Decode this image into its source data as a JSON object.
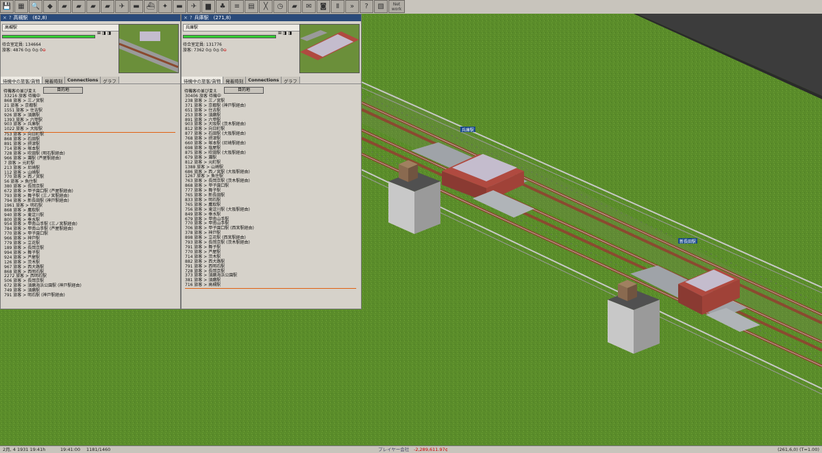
{
  "toolbar": {
    "buttons": [
      {
        "icon": "disk-icon",
        "glyph": "💾"
      },
      {
        "icon": "map-icon",
        "glyph": "▦"
      },
      {
        "icon": "magnifier-icon",
        "glyph": "🔍"
      },
      {
        "icon": "terrain-icon",
        "glyph": "◆"
      },
      {
        "icon": "road-icon",
        "glyph": "▰"
      },
      {
        "icon": "rail-icon",
        "glyph": "▰"
      },
      {
        "icon": "tram-icon",
        "glyph": "▰"
      },
      {
        "icon": "monorail-icon",
        "glyph": "▰"
      },
      {
        "icon": "plane-icon",
        "glyph": "✈"
      },
      {
        "icon": "train-icon",
        "glyph": "▬"
      },
      {
        "icon": "ship-icon",
        "glyph": "⛴"
      },
      {
        "icon": "signal-icon",
        "glyph": "✦"
      },
      {
        "icon": "ferry-icon",
        "glyph": "▬"
      },
      {
        "icon": "plane2-icon",
        "glyph": "✈"
      },
      {
        "icon": "truck-icon",
        "glyph": "▆"
      },
      {
        "icon": "tree-icon",
        "glyph": "♣"
      },
      {
        "icon": "list-icon",
        "glyph": "≡"
      },
      {
        "icon": "document-icon",
        "glyph": "▤"
      },
      {
        "icon": "crossing-icon",
        "glyph": "╳"
      },
      {
        "icon": "schedule-icon",
        "glyph": "◷"
      },
      {
        "icon": "folder-icon",
        "glyph": "▰"
      },
      {
        "icon": "message-icon",
        "glyph": "✉"
      },
      {
        "icon": "camera-icon",
        "glyph": "◙"
      },
      {
        "icon": "pause-icon",
        "glyph": "Ⅱ"
      },
      {
        "icon": "fastforward-icon",
        "glyph": "»"
      },
      {
        "icon": "help-icon",
        "glyph": "?"
      },
      {
        "icon": "grid-icon",
        "glyph": "▧"
      }
    ],
    "network_label": "Net work"
  },
  "windows": [
    {
      "title": "高槻駅　(62,8)",
      "station_name": "高槻駅",
      "capacity": "待合室定員: 134664",
      "waiting": "旅客: 4876",
      "goods_a": "0",
      "goods_b": "0",
      "mail": "0",
      "tabs": [
        "待機中の旅客/貨物",
        "発着時刻",
        "Connections",
        "グラフ"
      ],
      "sort_label": "待機客の並び変え",
      "sort_button": "目的地",
      "rows": [
        "33216 旅客 待機中",
        "868 旅客 > 三ノ宮駅",
        "21 旅客 > 京都駅",
        "1551 旅客 > 住吉駅",
        "926 旅客 > 須磨駅",
        "1393 旅客 > 六甲駅",
        "903 旅客 > 兵庫駅",
        "1022 旅客 > 大阪駅",
        "753 旅客 > 向日町駅",
        "868 旅客 > 石田駅",
        "891 旅客 > 摂津駅",
        "714 旅客 > 塚本駅",
        "728 旅客 > 吹田駅 (明石駅経由)",
        "966 旅客 > 灘駅 (芦屋駅経由)",
        "7 旅客 > 元町駅",
        "213 旅客 > 尼崎駅",
        "112 旅客 > 山崎駅",
        "770 旅客 > 西ノ宮駅",
        "56 旅客 > 魚住駅",
        "380 旅客 > 長岡京駅",
        "672 旅客 > 甲子園口駅 (芦屋駅経由)",
        "793 旅客 > 舞子駅 (三ノ宮駅経由)",
        "794 旅客 > 新長田駅 (神戸駅経由)",
        "1961 旅客 > 明石駅",
        "868 旅客 > 鷹取駅",
        "940 旅客 > 東淀川駅",
        "800 旅客 > 垂水駅",
        "954 旅客 > 甲南山手駅 (三ノ宮駅経由)",
        "784 旅客 > 甲南山手駅 (芦屋駅経由)",
        "770 旅客 > 甲子園口駅",
        "966 旅客 > 神戸駅",
        "779 旅客 > 立花駅",
        "189 旅客 > 長岡京駅",
        "994 旅客 > 舞子駅",
        "924 旅客 > 芦屋駅",
        "126 旅客 > 茨木駅",
        "967 旅客 > 西大路駅",
        "868 旅客 > 西明石駅",
        "2272 旅客 > 西明石駅",
        "506 旅客 > 長岡京駅",
        "672 旅客 > 須磨海浜公園駅 (神戸駅経由)",
        "749 旅客 > 須磨駅",
        "791 旅客 > 明石駅 (神戸駅経由)"
      ],
      "highlight_index": 7
    },
    {
      "title": "兵庫駅　(271,8)",
      "station_name": "兵庫駅",
      "capacity": "待合室定員: 131776",
      "waiting": "旅客: 7362",
      "goods_a": "0",
      "goods_b": "0",
      "mail": "0",
      "tabs": [
        "待機中の旅客/貨物",
        "発着時刻",
        "Connections",
        "グラフ"
      ],
      "sort_label": "待機客の並び変え",
      "sort_button": "目的地",
      "rows": [
        "30406 旅客 待機中",
        "238 旅客 > 三ノ宮駅",
        "371 旅客 > 京都駅 (神戸駅経由)",
        "651 旅客 > 住吉駅",
        "253 旅客 > 須磨駅",
        "891 旅客 > 六甲駅",
        "903 旅客 > 大阪駅 (茨木駅経由)",
        "812 旅客 > 向日町駅",
        "877 旅客 > 石田駅 (大阪駅経由)",
        "768 旅客 > 摂津駅",
        "660 旅客 > 塚本駅 (尼崎駅経由)",
        "698 旅客 > 塩屋駅",
        "875 旅客 > 吹田駅 (大阪駅経由)",
        "679 旅客 > 灘駅",
        "812 旅客 > 元町駅",
        "1388 旅客 > 山崎駅",
        "686 旅客 > 西ノ宮駅 (大阪駅経由)",
        "1267 旅客 > 魚住駅",
        "763 旅客 > 長岡京駅 (茨木駅経由)",
        "868 旅客 > 甲子園口駅",
        "777 旅客 > 舞子駅",
        "765 旅客 > 新長田駅",
        "833 旅客 > 明石駅",
        "765 旅客 > 鷹取駅",
        "756 旅客 > 東淀川駅 (大阪駅経由)",
        "849 旅客 > 垂水駅",
        "679 旅客 > 甲南山手駅",
        "770 旅客 > 甲南山手駅",
        "706 旅客 > 甲子園口駅 (西宮駅経由)",
        "378 旅客 > 神戸駅",
        "898 旅客 > 立花駅 (西宮駅経由)",
        "793 旅客 > 長岡京駅 (茨木駅経由)",
        "791 旅客 > 舞子駅",
        "770 旅客 > 芦屋駅",
        "714 旅客 > 茨木駅",
        "882 旅客 > 西大路駅",
        "791 旅客 > 西明石駅",
        "728 旅客 > 長岡京駅",
        "373 旅客 > 須磨海浜公園駅",
        "381 旅客 > 須磨駅",
        "716 旅客 > 高槻駅"
      ],
      "highlight_index": 40
    }
  ],
  "map_labels": {
    "station_a": "兵庫駅",
    "station_b": "新長田駅"
  },
  "status": {
    "date": "2月, 4 1931 19:41h",
    "time": "19:41:00",
    "counter": "1181/1460",
    "company": "プレイヤー会社",
    "money": "-2,289,611.97¢",
    "coords": "(261,6,0) (T=1.00)"
  },
  "colors": {
    "grass": "#5a8c2a",
    "ground_dark": "#3a3a3a",
    "rail": "#8a4a30",
    "window_bg": "#d6d2ca",
    "title_bar": "#2a4a7a",
    "money": "#cc0000"
  }
}
